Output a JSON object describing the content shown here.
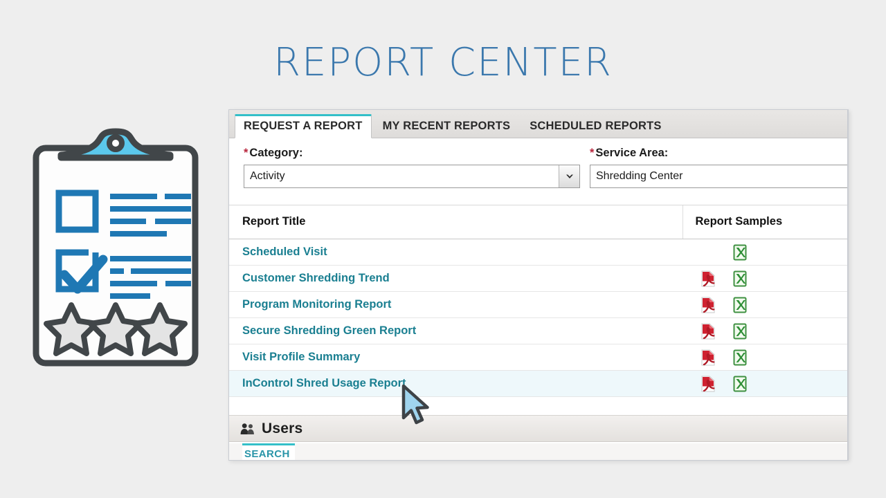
{
  "page": {
    "title": "REPORT CENTER",
    "background_color": "#eeeeee",
    "title_color": "#3b78ad"
  },
  "illustration": {
    "name": "clipboard-checklist-illustration",
    "clip_color": "#5bc8ec",
    "outline_color": "#414649",
    "accent_color": "#1f78b4",
    "star_fill": "#e4e4e4",
    "board_color": "#fdfdfd",
    "stars_count": 3
  },
  "panel": {
    "tabs": [
      {
        "label": "REQUEST A REPORT",
        "active": true
      },
      {
        "label": "MY RECENT REPORTS",
        "active": false
      },
      {
        "label": "SCHEDULED REPORTS",
        "active": false
      }
    ],
    "active_tab_accent": "#33bfc8",
    "form": {
      "category": {
        "label": "Category:",
        "required_marker": "*",
        "value": "Activity",
        "control": "dropdown"
      },
      "service_area": {
        "label": "Service Area:",
        "required_marker": "*",
        "value": "Shredding Center",
        "control": "textbox"
      }
    },
    "table": {
      "columns": [
        "Report Title",
        "Report Samples"
      ],
      "rows": [
        {
          "title": "Scheduled Visit",
          "pdf": false,
          "excel": true,
          "hovered": false
        },
        {
          "title": "Customer Shredding Trend",
          "pdf": true,
          "excel": true,
          "hovered": false
        },
        {
          "title": "Program Monitoring Report",
          "pdf": true,
          "excel": true,
          "hovered": false
        },
        {
          "title": "Secure Shredding Green Report",
          "pdf": true,
          "excel": true,
          "hovered": false
        },
        {
          "title": "Visit Profile Summary",
          "pdf": true,
          "excel": true,
          "hovered": false
        },
        {
          "title": "InControl Shred Usage Report",
          "pdf": true,
          "excel": true,
          "hovered": true
        }
      ],
      "link_color": "#1a7f91"
    },
    "users_section": {
      "title": "Users",
      "icon": "users-group-icon",
      "subtabs": [
        {
          "label": "SEARCH",
          "active": true
        }
      ]
    }
  },
  "cursor": {
    "name": "mouse-pointer",
    "fill": "#9fd4ee",
    "stroke": "#3d4246"
  }
}
